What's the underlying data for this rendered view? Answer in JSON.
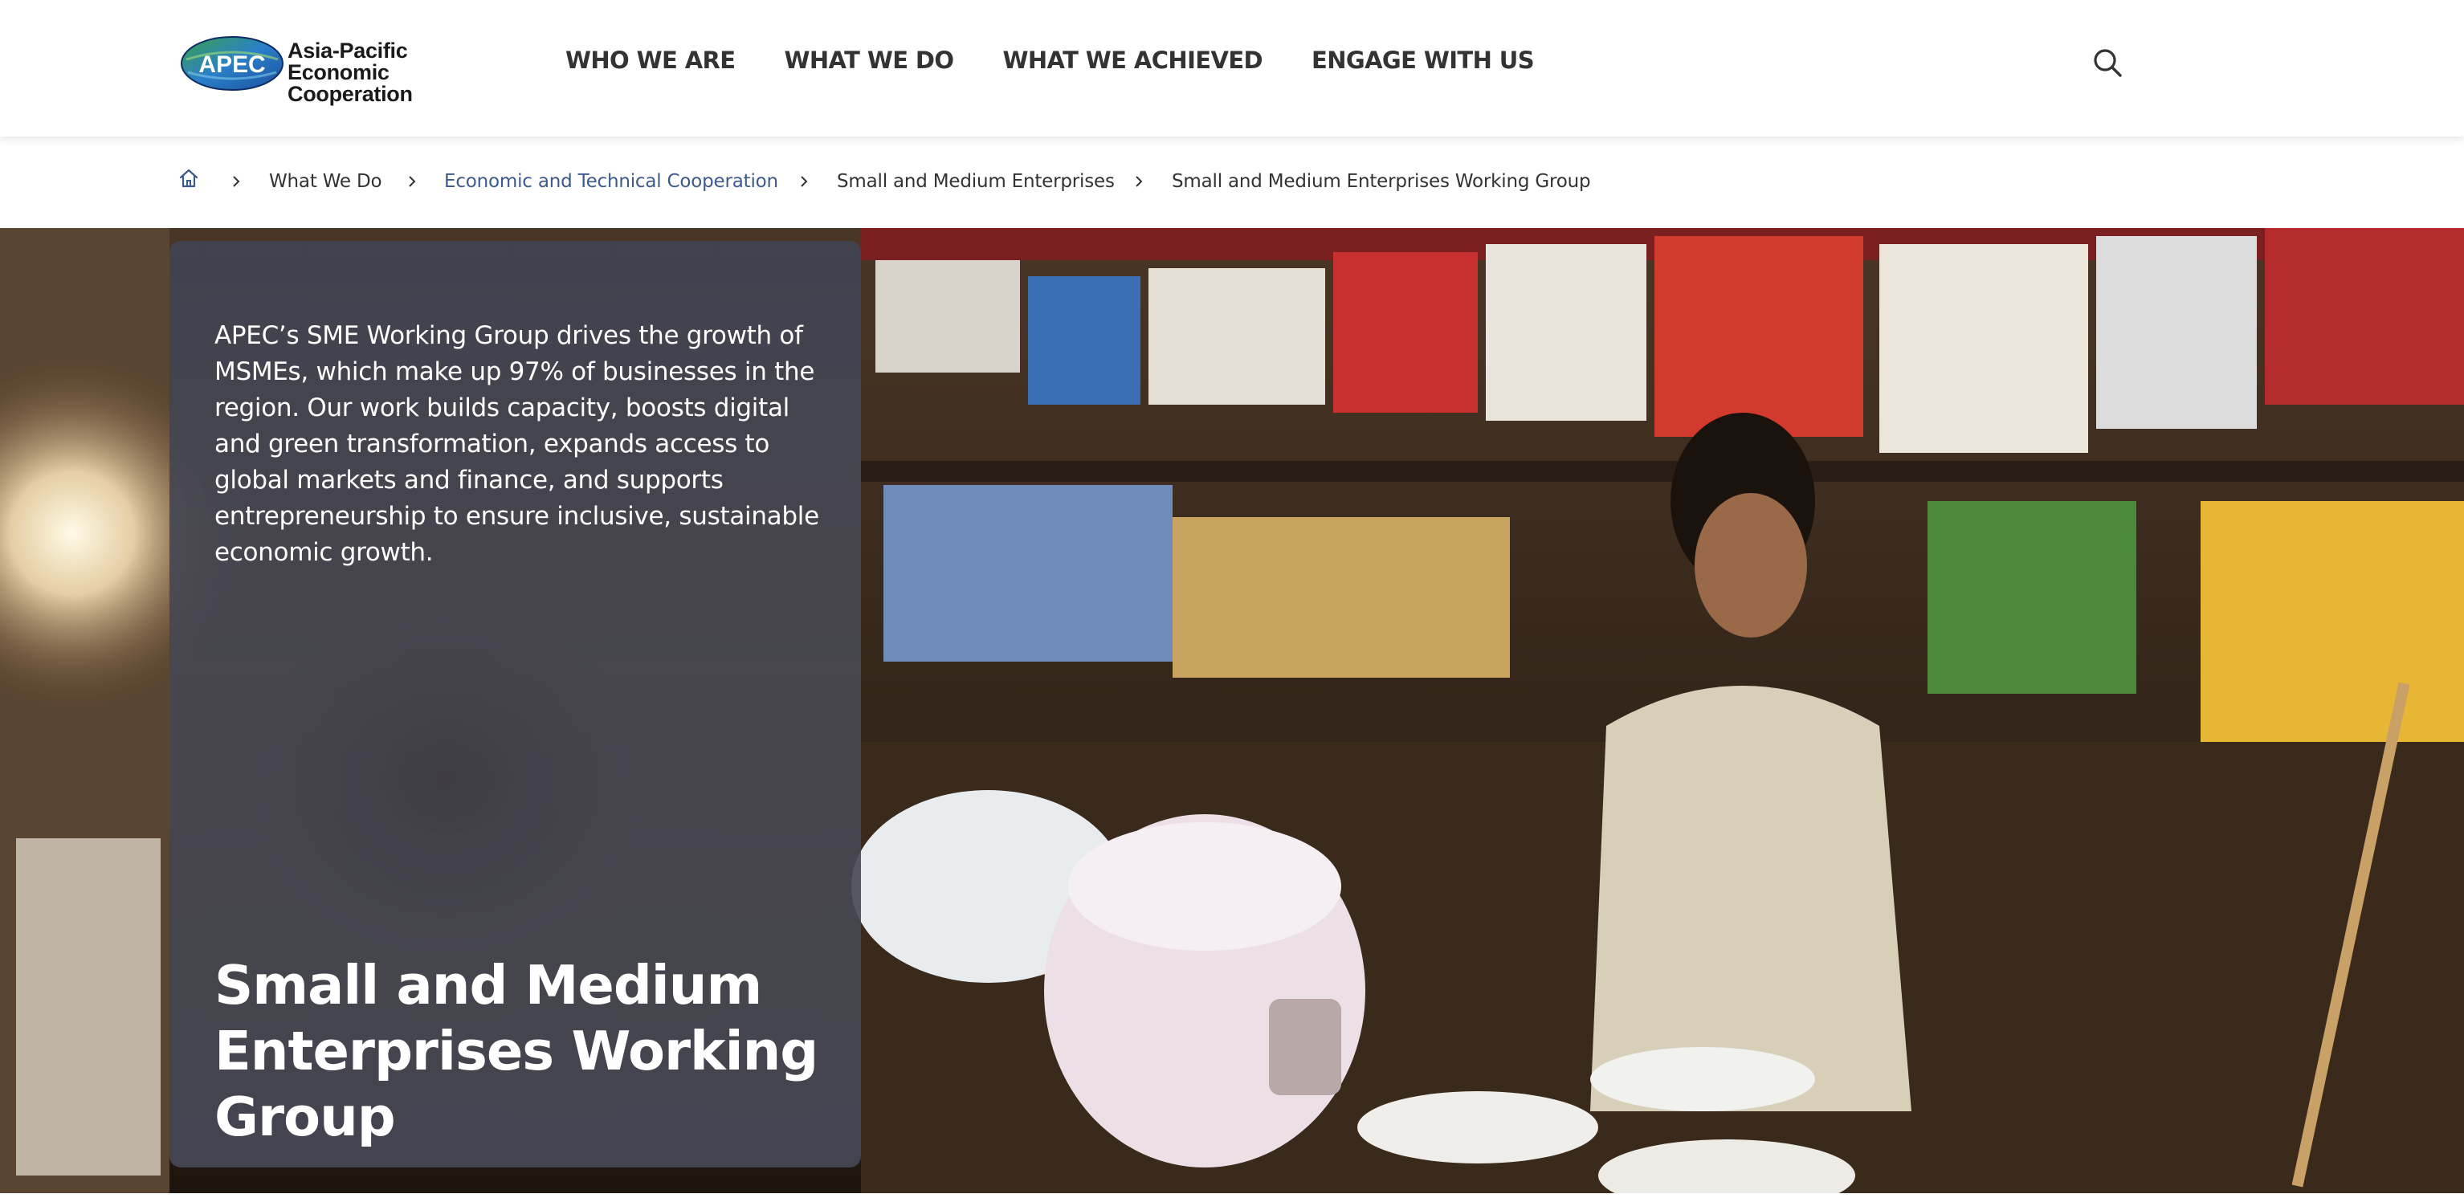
{
  "header": {
    "logo": {
      "badge_text": "APEC",
      "line1": "Asia-Pacific",
      "line2": "Economic Cooperation"
    },
    "nav": [
      {
        "label": "WHO WE ARE"
      },
      {
        "label": "WHAT WE DO"
      },
      {
        "label": "WHAT WE ACHIEVED"
      },
      {
        "label": "ENGAGE WITH US"
      }
    ],
    "search_icon": "search-icon"
  },
  "breadcrumb": {
    "home_icon": "home-icon",
    "items": [
      {
        "label": "What We Do"
      },
      {
        "label": "Economic and Technical Cooperation"
      },
      {
        "label": "Small and Medium Enterprises"
      },
      {
        "label": "Small and Medium Enterprises Working Group"
      }
    ]
  },
  "hero": {
    "description": "APEC’s SME Working Group drives the growth of MSMEs, which make up 97% of businesses in the region. Our work builds capacity, boosts digital and green transformation, expands access to global markets and finance, and supports entrepreneurship to ensure inclusive, sustainable economic growth.",
    "title": "Small and Medium Enterprises Working Group"
  },
  "colors": {
    "link": "#3d5a8f",
    "nav_text": "#333333",
    "card_overlay": "#464a58",
    "logo_blue": "#1f4ea3",
    "logo_green": "#2e9b45"
  }
}
